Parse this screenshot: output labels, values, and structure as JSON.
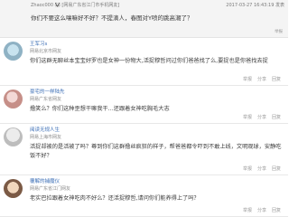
{
  "first_comment": {
    "meta_left": "Zhaoc000 🐼 [网易广东省江门市手机网友]",
    "meta_right": "2017-03-27 16:43:19 发表",
    "text": "你们不要这么嚷嘛好不好？不提滴人，春图对Y喷的跳高潮了？",
    "actions": "举报"
  },
  "comments": [
    {
      "username": "王军习s",
      "location": "网易北京市网友",
      "text": "你们这群无聊丝本宝宝好罗也是女神一份物大,活捉穆哲问过你们爸爸找了么,要捉也是你爸找去捉",
      "actions": [
        "举报",
        "分享",
        "回复"
      ]
    },
    {
      "username": "豪宅的一样陆先",
      "location": "网易广东省网友",
      "text": "撸笑么？你们这种歪想干嘛我干…还跟着女神吃胸毛大志",
      "actions": [
        "举报",
        "分享",
        "回复"
      ]
    },
    {
      "username": "阅读无规人生",
      "location": "网易上海市网友",
      "text": "活捉却被的是活被了吗？尊到你们这群撸丝疯狂的样子，帮爸爸都令吓到不敢上线，文明观球，安静吃饭不好？",
      "actions": [
        "举报",
        "分享",
        "回复"
      ]
    },
    {
      "username": "覆解的捕魔仪",
      "location": "网易广东省江门网友",
      "text": "老实巴拉跟着女神吃肉不好么？还活捉穆哲,请问你们能养得上了吗？",
      "actions": [
        "举报",
        "分享",
        "回复"
      ]
    }
  ]
}
